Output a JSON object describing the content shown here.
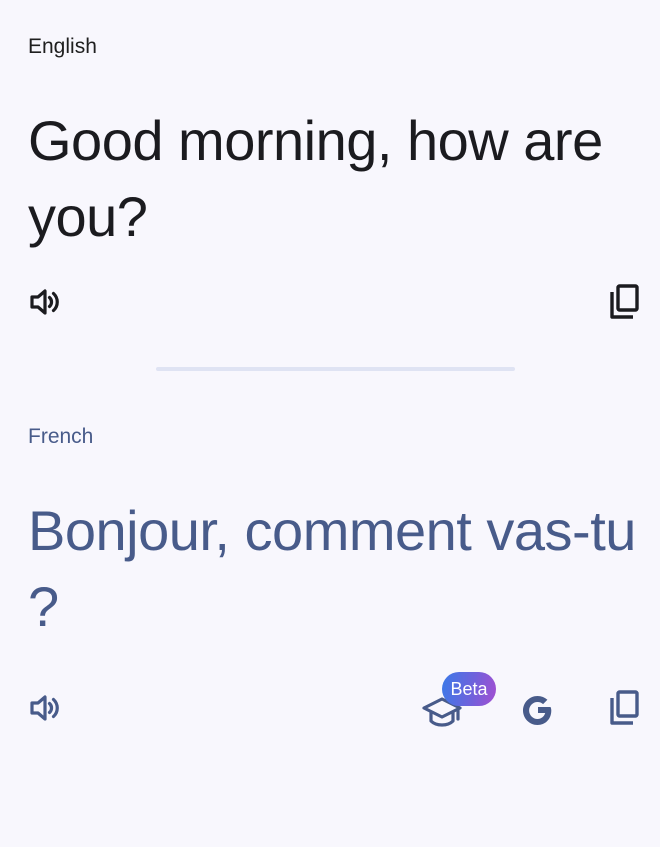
{
  "source": {
    "language": "English",
    "text": "Good morning, how are you?",
    "icons": {
      "speak": "speaker-icon",
      "copy": "copy-icon"
    }
  },
  "target": {
    "language": "French",
    "text": "Bonjour, comment vas-tu ?",
    "badge": "Beta",
    "icons": {
      "speak": "speaker-icon",
      "learn": "graduation-cap-icon",
      "google": "google-g-icon",
      "copy": "copy-icon"
    }
  },
  "colors": {
    "background": "#f8f7fd",
    "source_text": "#1b1b1f",
    "target_text": "#485b8a",
    "divider": "#dfe3f3",
    "badge_gradient": [
      "#3b7ae8",
      "#a34fd1"
    ]
  }
}
